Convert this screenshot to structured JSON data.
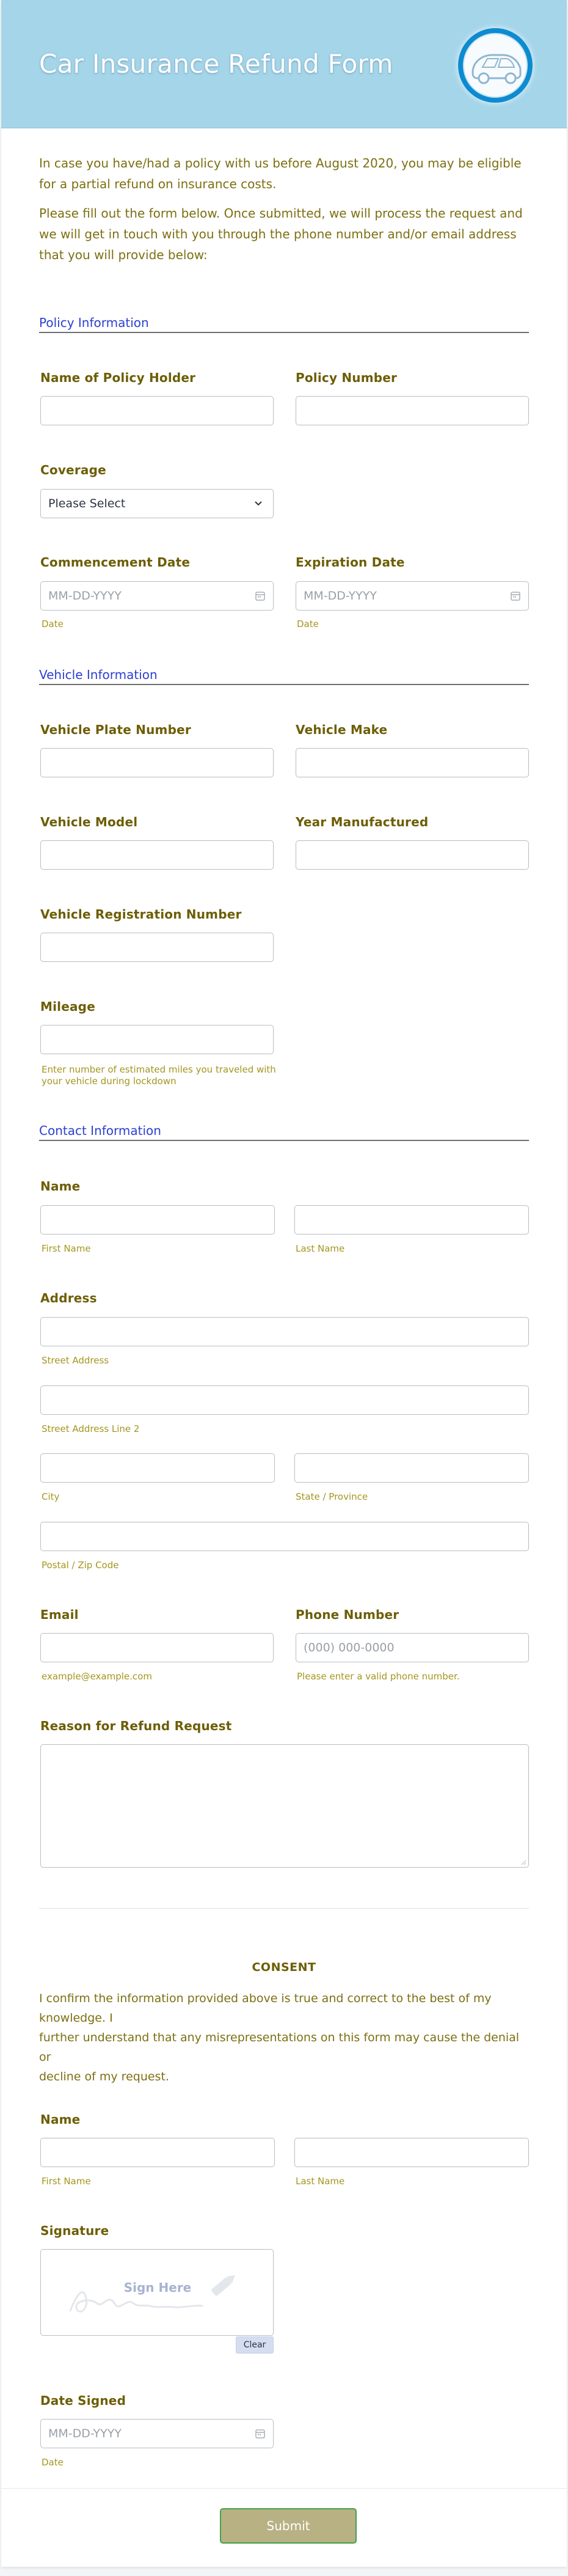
{
  "header": {
    "title": "Car Insurance Refund Form",
    "logo": "car-shield-logo-icon",
    "colors": {
      "banner": "#a5d5e9",
      "logo_ring": "#0d8bd1"
    }
  },
  "intro": {
    "paragraph_1": "In case you have/had a policy with us before August 2020, you may be eligible for a partial refund on insurance costs.",
    "paragraph_2": "Please fill out the form below. Once submitted, we will process the request and we will get in touch with you through the phone number and/or email address  that you will provide below:"
  },
  "policy_section": {
    "title": "Policy Information",
    "holder_name_label": "Name of Policy Holder",
    "policy_number_label": "Policy Number",
    "coverage_label": "Coverage",
    "coverage_value": "Please Select",
    "commencement_label": "Commencement Date",
    "commencement_placeholder": "MM-DD-YYYY",
    "commencement_hint": "Date",
    "expiration_label": "Expiration Date",
    "expiration_placeholder": "MM-DD-YYYY",
    "expiration_hint": "Date"
  },
  "vehicle_section": {
    "title": "Vehicle Information",
    "plate_label": "Vehicle Plate Number",
    "make_label": "Vehicle Make",
    "model_label": "Vehicle Model",
    "year_label": "Year Manufactured",
    "registration_label": "Vehicle Registration Number",
    "mileage_label": "Mileage",
    "mileage_hint_1": "Enter number of estimated miles you traveled with",
    "mileage_hint_2": "your vehicle during lockdown"
  },
  "contact_section": {
    "title": "Contact Information",
    "name_label": "Name",
    "first_name_hint": "First Name",
    "last_name_hint": "Last Name",
    "address_label": "Address",
    "street_hint": "Street Address",
    "street2_hint": "Street Address Line 2",
    "city_hint": "City",
    "state_hint": "State / Province",
    "zip_hint": "Postal / Zip Code",
    "email_label": "Email",
    "email_hint": "example@example.com",
    "phone_label": "Phone Number",
    "phone_placeholder": "(000) 000-0000",
    "phone_hint": "Please enter a valid phone number.",
    "reason_label": "Reason for Refund Request"
  },
  "consent": {
    "title": "CONSENT",
    "text_1": "I confirm the information provided above is true and correct to the best of my knowledge. I",
    "text_2": "further understand that any misrepresentations on this form may cause the denial or",
    "text_3": "decline of my request.",
    "name_label": "Name",
    "first_name_hint": "First Name",
    "last_name_hint": "Last Name",
    "signature_label": "Signature",
    "signature_placeholder": "Sign Here",
    "clear_label": "Clear",
    "date_label": "Date Signed",
    "date_placeholder": "MM-DD-YYYY",
    "date_hint": "Date"
  },
  "footer": {
    "submit_label": "Submit"
  }
}
